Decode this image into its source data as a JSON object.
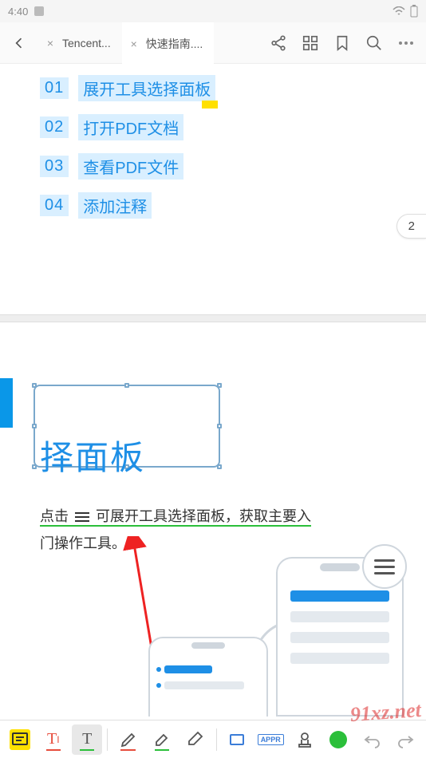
{
  "statusbar": {
    "time": "4:40"
  },
  "topbar": {
    "tabs": [
      {
        "label": "Tencent..."
      },
      {
        "label": "快速指南...."
      }
    ]
  },
  "toc": {
    "items": [
      {
        "num": "01",
        "text": "展开工具选择面板"
      },
      {
        "num": "02",
        "text": "打开PDF文档"
      },
      {
        "num": "03",
        "text": "查看PDF文件"
      },
      {
        "num": "04",
        "text": "添加注释"
      }
    ]
  },
  "page_indicator": "2",
  "section": {
    "heading_visible": "择面板",
    "para_line1_a": "点击",
    "para_line1_b": "可展开工具选择面板，获取主要入",
    "para_line2": "门操作工具。"
  },
  "toolbar": {
    "approve_label": "APPR"
  },
  "watermark": "91xz.net"
}
